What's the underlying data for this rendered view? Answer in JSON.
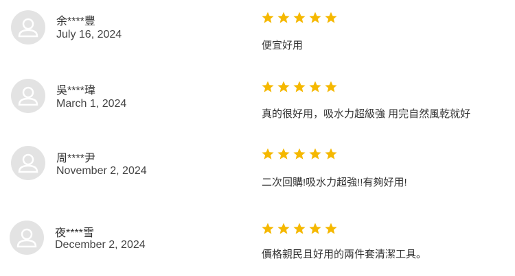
{
  "colors": {
    "star": "#f5b800",
    "avatar_bg": "#e3e3e3",
    "avatar_icon": "#ffffff"
  },
  "reviews": [
    {
      "name": "余****豐",
      "date": "July 16, 2024",
      "rating": 5,
      "comment": "便宜好用",
      "avatar_icon": "user-silhouette-icon"
    },
    {
      "name": "吳****瑋",
      "date": "March 1, 2024",
      "rating": 5,
      "comment": "真的很好用，吸水力超級強 用完自然風乾就好",
      "avatar_icon": "user-silhouette-icon"
    },
    {
      "name": "周****尹",
      "date": "November 2, 2024",
      "rating": 5,
      "comment": "二次回購!吸水力超強!!有夠好用!",
      "avatar_icon": "user-silhouette-icon"
    },
    {
      "name": "夜****雪",
      "date": "December 2, 2024",
      "rating": 5,
      "comment": "價格親民且好用的兩件套清潔工具。",
      "avatar_icon": "user-silhouette-icon"
    }
  ]
}
